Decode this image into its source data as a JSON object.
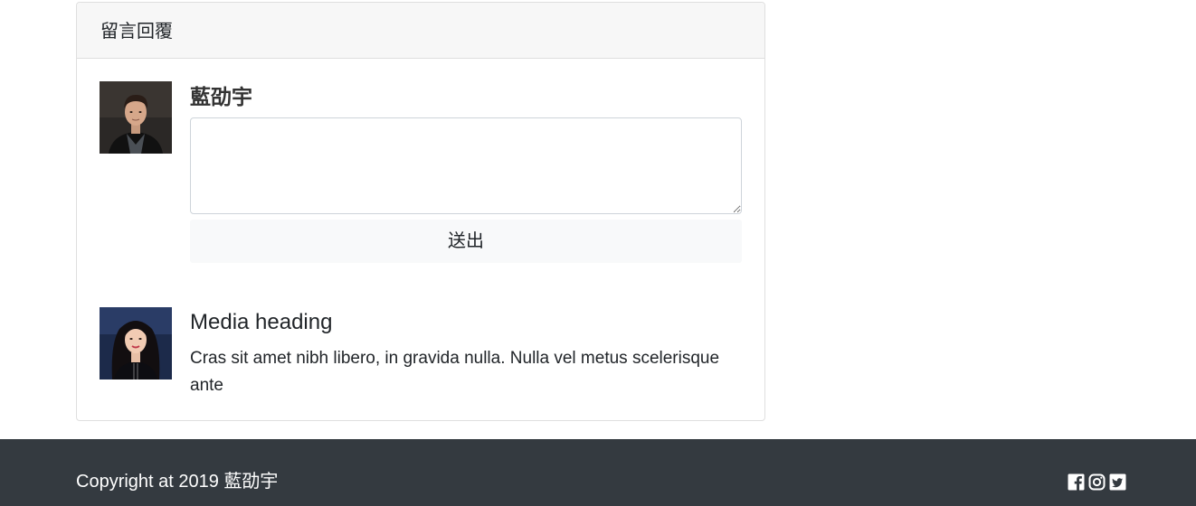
{
  "card": {
    "title": "留言回覆"
  },
  "reply": {
    "user_name": "藍劭宇",
    "textarea_value": "",
    "textarea_placeholder": "",
    "submit_label": "送出"
  },
  "comment": {
    "heading": "Media heading",
    "text": "Cras sit amet nibh libero, in gravida nulla. Nulla vel metus scelerisque ante"
  },
  "footer": {
    "copyright": "Copyright at 2019 藍劭宇",
    "social_icons": [
      "facebook-icon",
      "instagram-icon",
      "twitter-icon"
    ]
  },
  "colors": {
    "footer_bg": "#343a40",
    "card_header_bg": "#f7f7f7",
    "button_bg": "#f8f9fa"
  }
}
